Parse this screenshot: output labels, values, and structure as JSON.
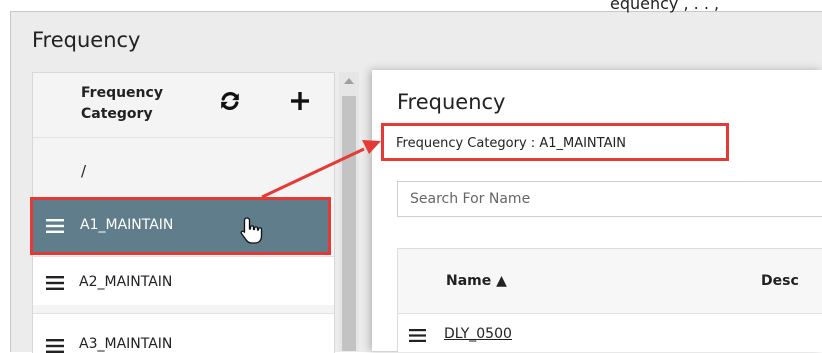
{
  "page": {
    "top_cutoff_text": "equency , . . ,",
    "title": "Frequency"
  },
  "sidebar": {
    "header_label": "Frequency\nCategory",
    "root_label": "/",
    "selected_label": "A1_MAINTAIN",
    "items": [
      {
        "label": "A2_MAINTAIN"
      },
      {
        "label": "A3_MAINTAIN"
      }
    ]
  },
  "panel": {
    "title": "Frequency",
    "category_text": "Frequency Category : A1_MAINTAIN",
    "search_placeholder": "Search For Name",
    "columns": {
      "name": "Name  ▲",
      "description": "Desc"
    },
    "rows": [
      {
        "name": "DLY_0500"
      }
    ]
  },
  "colors": {
    "selected_bg": "#607d8b",
    "highlight_red": "#e53935"
  },
  "icons": {
    "refresh": "refresh-icon",
    "add": "plus-icon",
    "menu": "hamburger-icon",
    "cursor": "hand-pointer-icon"
  }
}
